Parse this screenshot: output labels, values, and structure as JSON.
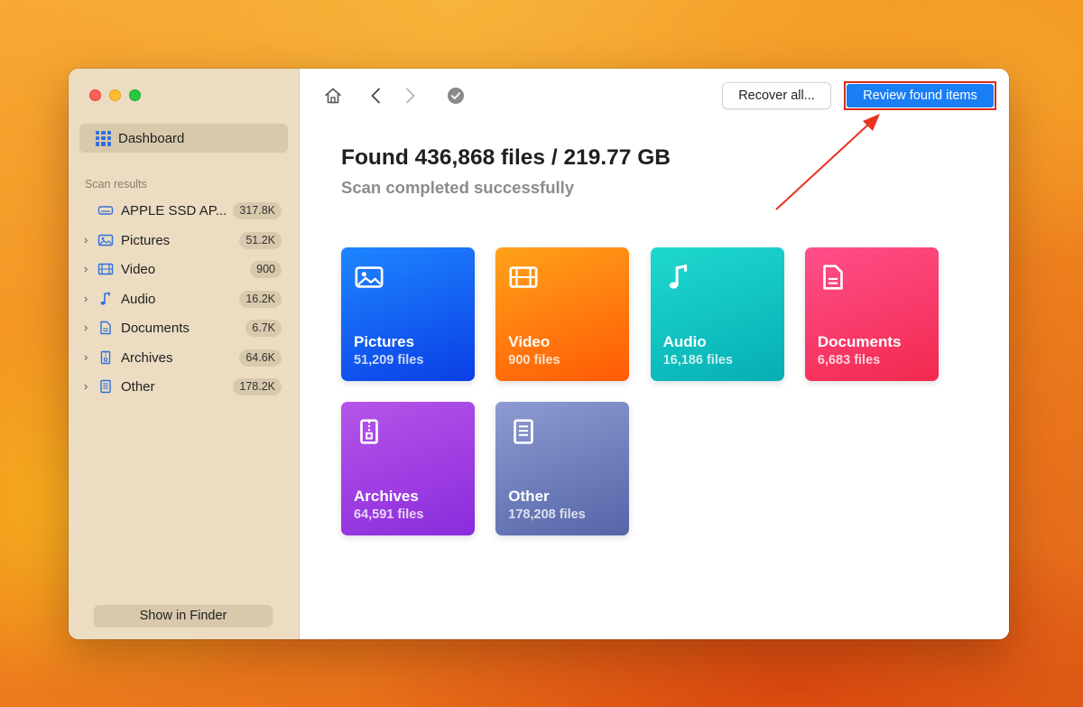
{
  "sidebar": {
    "dashboard_label": "Dashboard",
    "section_label": "Scan results",
    "items": [
      {
        "label": "APPLE SSD AP...",
        "count": "317.8K",
        "icon": "drive-icon",
        "expandable": false
      },
      {
        "label": "Pictures",
        "count": "51.2K",
        "icon": "picture-icon",
        "expandable": true
      },
      {
        "label": "Video",
        "count": "900",
        "icon": "film-icon",
        "expandable": true
      },
      {
        "label": "Audio",
        "count": "16.2K",
        "icon": "music-note-icon",
        "expandable": true
      },
      {
        "label": "Documents",
        "count": "6.7K",
        "icon": "document-icon",
        "expandable": true
      },
      {
        "label": "Archives",
        "count": "64.6K",
        "icon": "archive-icon",
        "expandable": true
      },
      {
        "label": "Other",
        "count": "178.2K",
        "icon": "file-icon",
        "expandable": true
      }
    ],
    "show_in_finder_label": "Show in Finder"
  },
  "toolbar": {
    "recover_all_label": "Recover all...",
    "review_label": "Review found items"
  },
  "main": {
    "title": "Found 436,868 files / 219.77 GB",
    "subtitle": "Scan completed successfully",
    "tiles": [
      {
        "name": "Pictures",
        "count": "51,209 files",
        "icon": "picture-icon",
        "from": "#1f86ff",
        "to": "#0a3ee6"
      },
      {
        "name": "Video",
        "count": "900 files",
        "icon": "film-icon",
        "from": "#ffa21a",
        "to": "#ff5a05"
      },
      {
        "name": "Audio",
        "count": "16,186 files",
        "icon": "music-note-icon",
        "from": "#1fd9cf",
        "to": "#05aeb4"
      },
      {
        "name": "Documents",
        "count": "6,683 files",
        "icon": "document-icon",
        "from": "#ff4f8a",
        "to": "#f2294e"
      },
      {
        "name": "Archives",
        "count": "64,591 files",
        "icon": "archive-icon",
        "from": "#b555e8",
        "to": "#8b2bdc"
      },
      {
        "name": "Other",
        "count": "178,208 files",
        "icon": "file-icon",
        "from": "#8e9bd2",
        "to": "#5565a7"
      }
    ]
  },
  "colors": {
    "accent": "#1a7ef5",
    "highlight_border": "#d9291c",
    "sidebar_bg": "#ebdcc2"
  }
}
